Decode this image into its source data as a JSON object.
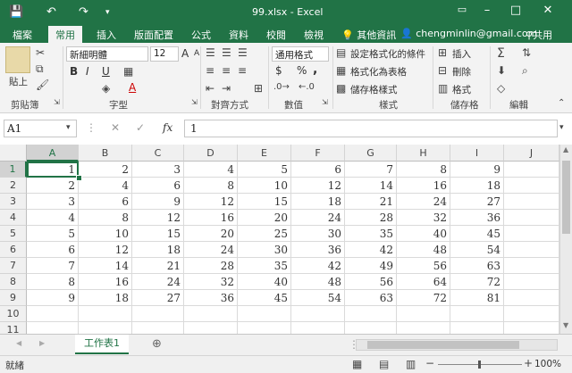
{
  "window": {
    "title": "99.xlsx - Excel"
  },
  "quick_access": {
    "undo": "↶",
    "redo": "↷"
  },
  "tabs": [
    "檔案",
    "常用",
    "插入",
    "版面配置",
    "公式",
    "資料",
    "校閱",
    "檢視"
  ],
  "active_tab": "常用",
  "tell_me": "其他資訊",
  "user": {
    "name": "chengminlin@gmail.com"
  },
  "share_label": "共用",
  "ribbon": {
    "clipboard": {
      "paste": "貼上",
      "label": "剪貼簿"
    },
    "font": {
      "name": "新細明體",
      "size": "12",
      "label": "字型",
      "grow": "A",
      "shrink": "A",
      "bold": "B",
      "italic": "I",
      "underline": "U",
      "font_color": "A"
    },
    "alignment": {
      "label": "對齊方式"
    },
    "number": {
      "format": "通用格式",
      "currency": "$",
      "percent": "%",
      "comma": ",",
      "label": "數值"
    },
    "styles": {
      "conditional": "設定格式化的條件",
      "table": "格式化為表格",
      "cell_styles": "儲存格樣式",
      "label": "樣式"
    },
    "cells": {
      "insert": "插入",
      "delete": "刪除",
      "format": "格式",
      "label": "儲存格"
    },
    "editing": {
      "label": "編輯"
    }
  },
  "formula_bar": {
    "name_box": "A1",
    "fx": "fx",
    "value": "1"
  },
  "columns": [
    "A",
    "B",
    "C",
    "D",
    "E",
    "F",
    "G",
    "H",
    "I",
    "J"
  ],
  "rows": [
    [
      "1",
      "2",
      "3",
      "4",
      "5",
      "6",
      "7",
      "8",
      "9"
    ],
    [
      "2",
      "4",
      "6",
      "8",
      "10",
      "12",
      "14",
      "16",
      "18"
    ],
    [
      "3",
      "6",
      "9",
      "12",
      "15",
      "18",
      "21",
      "24",
      "27"
    ],
    [
      "4",
      "8",
      "12",
      "16",
      "20",
      "24",
      "28",
      "32",
      "36"
    ],
    [
      "5",
      "10",
      "15",
      "20",
      "25",
      "30",
      "35",
      "40",
      "45"
    ],
    [
      "6",
      "12",
      "18",
      "24",
      "30",
      "36",
      "42",
      "48",
      "54"
    ],
    [
      "7",
      "14",
      "21",
      "28",
      "35",
      "42",
      "49",
      "56",
      "63"
    ],
    [
      "8",
      "16",
      "24",
      "32",
      "40",
      "48",
      "56",
      "64",
      "72"
    ],
    [
      "9",
      "18",
      "27",
      "36",
      "45",
      "54",
      "63",
      "72",
      "81"
    ],
    [
      "",
      "",
      "",
      "",
      "",
      "",
      "",
      "",
      ""
    ],
    [
      "",
      "",
      "",
      "",
      "",
      "",
      "",
      "",
      ""
    ]
  ],
  "row_numbers": [
    "1",
    "2",
    "3",
    "4",
    "5",
    "6",
    "7",
    "8",
    "9",
    "10",
    "11"
  ],
  "sheet_tab": "工作表1",
  "status": {
    "ready": "就緒",
    "zoom": "100%"
  }
}
